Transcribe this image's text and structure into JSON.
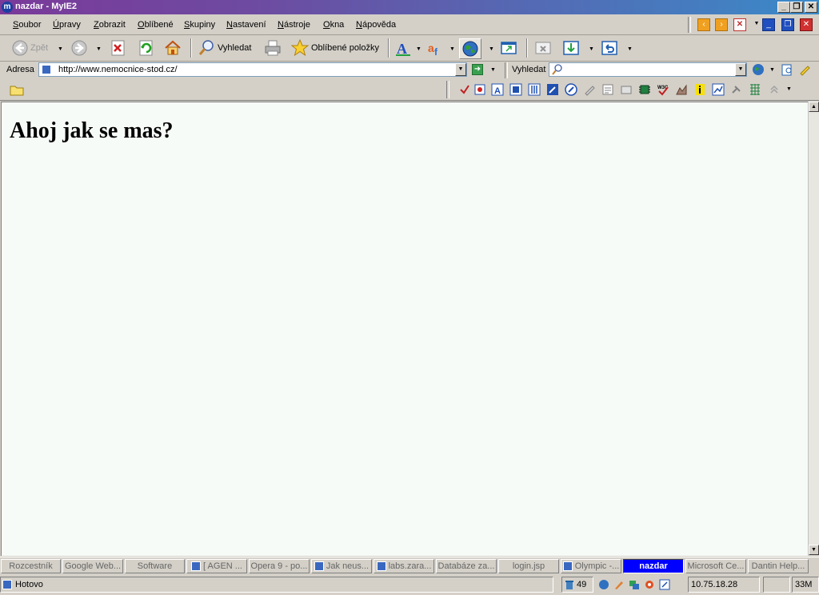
{
  "window": {
    "title": "nazdar - MyIE2",
    "controls": {
      "minimize": "_",
      "restore": "❐",
      "close": "✕"
    }
  },
  "menu": [
    {
      "label": "Soubor",
      "u": "S",
      "rest": "oubor"
    },
    {
      "label": "Úpravy",
      "u": "Ú",
      "rest": "pravy"
    },
    {
      "label": "Zobrazit",
      "u": "Z",
      "rest": "obrazit"
    },
    {
      "label": "Oblíbené",
      "u": "O",
      "rest": "blíbené"
    },
    {
      "label": "Skupiny",
      "u": "S",
      "rest": "kupiny"
    },
    {
      "label": "Nastavení",
      "u": "N",
      "rest": "astavení"
    },
    {
      "label": "Nástroje",
      "u": "N",
      "rest": "ástroje"
    },
    {
      "label": "Okna",
      "u": "O",
      "rest": "kna"
    },
    {
      "label": "Nápověda",
      "u": "N",
      "rest": "ápověda"
    }
  ],
  "toolbar": {
    "back": "Zpět",
    "search": "Vyhledat",
    "favorites": "Oblíbené položky"
  },
  "address": {
    "label": "Adresa",
    "url": "http://www.nemocnice-stod.cz/",
    "search_label": "Vyhledat",
    "search_value": ""
  },
  "page": {
    "heading": "Ahoj jak se mas?"
  },
  "tabs": [
    {
      "label": "Rozcestník",
      "icon": false,
      "active": false
    },
    {
      "label": "Google Web...",
      "icon": false,
      "active": false
    },
    {
      "label": "Software",
      "icon": false,
      "active": false
    },
    {
      "label": "[ AGEN ...",
      "icon": true,
      "active": false
    },
    {
      "label": "Opera 9 - po...",
      "icon": false,
      "active": false
    },
    {
      "label": "Jak neus...",
      "icon": true,
      "active": false
    },
    {
      "label": "labs.zara...",
      "icon": true,
      "active": false
    },
    {
      "label": "Databáze za...",
      "icon": false,
      "active": false
    },
    {
      "label": "login.jsp",
      "icon": false,
      "active": false
    },
    {
      "label": "Olympic -...",
      "icon": true,
      "active": false
    },
    {
      "label": "nazdar",
      "icon": false,
      "active": true
    },
    {
      "label": "Microsoft Ce...",
      "icon": false,
      "active": false
    },
    {
      "label": "Dantin Help...",
      "icon": false,
      "active": false
    }
  ],
  "status": {
    "text": "Hotovo",
    "count": "49",
    "ip": "10.75.18.28",
    "memory": "33M"
  },
  "colors": {
    "accent": "#0000ff",
    "page_bg": "#f7fbf7",
    "chrome": "#d4d0c8"
  }
}
